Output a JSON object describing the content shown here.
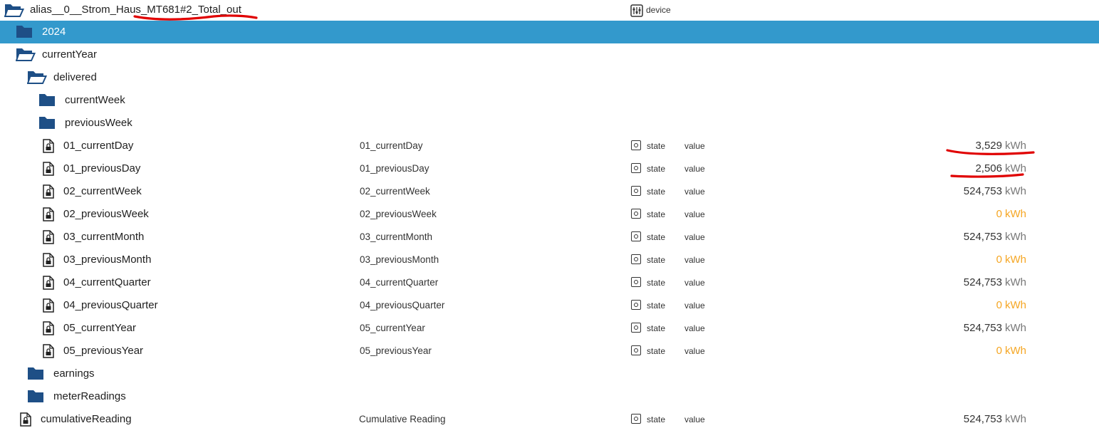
{
  "header": {
    "alias_prefix": "alias__0__Strom_Haus",
    "alias_underlined": "_MT681#2_Total_out",
    "device_label": "device",
    "device_icon": "device-icon"
  },
  "rows": [
    {
      "kind": "folder",
      "label": "2024",
      "selected": true
    },
    {
      "kind": "folder-open",
      "label": "currentYear"
    },
    {
      "kind": "folder-open",
      "label": "delivered"
    },
    {
      "kind": "folder",
      "label": "currentWeek"
    },
    {
      "kind": "folder",
      "label": "previousWeek"
    },
    {
      "kind": "state",
      "label": "01_currentDay",
      "name": "01_currentDay",
      "type": "state",
      "role": "value",
      "value": "3,529",
      "unit": "kWh",
      "zero": false
    },
    {
      "kind": "state",
      "label": "01_previousDay",
      "name": "01_previousDay",
      "type": "state",
      "role": "value",
      "value": "2,506",
      "unit": "kWh",
      "zero": false
    },
    {
      "kind": "state",
      "label": "02_currentWeek",
      "name": "02_currentWeek",
      "type": "state",
      "role": "value",
      "value": "524,753",
      "unit": "kWh",
      "zero": false
    },
    {
      "kind": "state",
      "label": "02_previousWeek",
      "name": "02_previousWeek",
      "type": "state",
      "role": "value",
      "value": "0",
      "unit": "kWh",
      "zero": true
    },
    {
      "kind": "state",
      "label": "03_currentMonth",
      "name": "03_currentMonth",
      "type": "state",
      "role": "value",
      "value": "524,753",
      "unit": "kWh",
      "zero": false
    },
    {
      "kind": "state",
      "label": "03_previousMonth",
      "name": "03_previousMonth",
      "type": "state",
      "role": "value",
      "value": "0",
      "unit": "kWh",
      "zero": true
    },
    {
      "kind": "state",
      "label": "04_currentQuarter",
      "name": "04_currentQuarter",
      "type": "state",
      "role": "value",
      "value": "524,753",
      "unit": "kWh",
      "zero": false
    },
    {
      "kind": "state",
      "label": "04_previousQuarter",
      "name": "04_previousQuarter",
      "type": "state",
      "role": "value",
      "value": "0",
      "unit": "kWh",
      "zero": true
    },
    {
      "kind": "state",
      "label": "05_currentYear",
      "name": "05_currentYear",
      "type": "state",
      "role": "value",
      "value": "524,753",
      "unit": "kWh",
      "zero": false
    },
    {
      "kind": "state",
      "label": "05_previousYear",
      "name": "05_previousYear",
      "type": "state",
      "role": "value",
      "value": "0",
      "unit": "kWh",
      "zero": true
    },
    {
      "kind": "folder",
      "label": "earnings"
    },
    {
      "kind": "folder",
      "label": "meterReadings"
    },
    {
      "kind": "state",
      "label": "cumulativeReading",
      "name": "Cumulative Reading",
      "type": "state",
      "role": "value",
      "value": "524,753",
      "unit": "kWh",
      "zero": false
    }
  ],
  "colors": {
    "selection": "#3399cc",
    "folder_icon": "#1e4f86",
    "zero_value": "#f5a623",
    "annotation": "#e00000"
  }
}
